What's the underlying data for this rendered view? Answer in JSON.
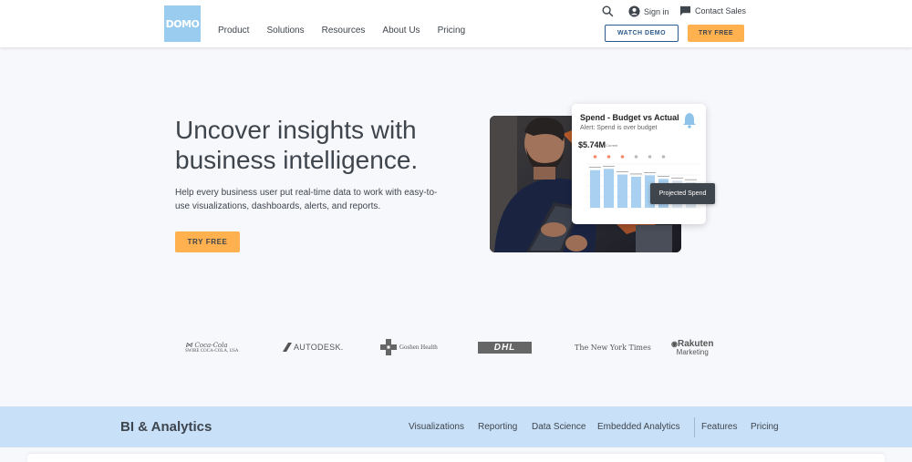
{
  "header": {
    "logo_text": "DOMO",
    "nav": [
      "Product",
      "Solutions",
      "Resources",
      "About Us",
      "Pricing"
    ],
    "sign_in": "Sign in",
    "contact_sales": "Contact Sales",
    "watch_demo": "WATCH DEMO",
    "try_free": "TRY FREE"
  },
  "hero": {
    "title": "Uncover insights with business intelligence.",
    "subtitle": "Help every business user put real-time data to work with easy-to-use visualizations, dashboards, alerts, and reports.",
    "cta": "TRY FREE"
  },
  "card": {
    "title": "Spend - Budget vs Actual",
    "alert": "Alert: Spend is over budget",
    "value": "$5.74M",
    "value_label": "Current",
    "tooltip": "Projected Spend",
    "bars": [
      0.86,
      0.89,
      0.76,
      0.71,
      0.74,
      0.66,
      0.62,
      0.58
    ]
  },
  "logos": [
    "SWIRE COCA-COLA, USA",
    "AUTODESK.",
    "Goshen Health",
    "DHL",
    "The New York Times",
    "Rakuten",
    "Marketing"
  ],
  "subnav": {
    "title": "BI & Analytics",
    "links": [
      "Visualizations",
      "Reporting",
      "Data Science",
      "Embedded Analytics"
    ],
    "links_right": [
      "Features",
      "Pricing"
    ]
  },
  "colors": {
    "accent": "#ffb04f",
    "brand": "#99ccee",
    "subnav_bg": "#c8e0f8",
    "text": "#3f454d"
  }
}
